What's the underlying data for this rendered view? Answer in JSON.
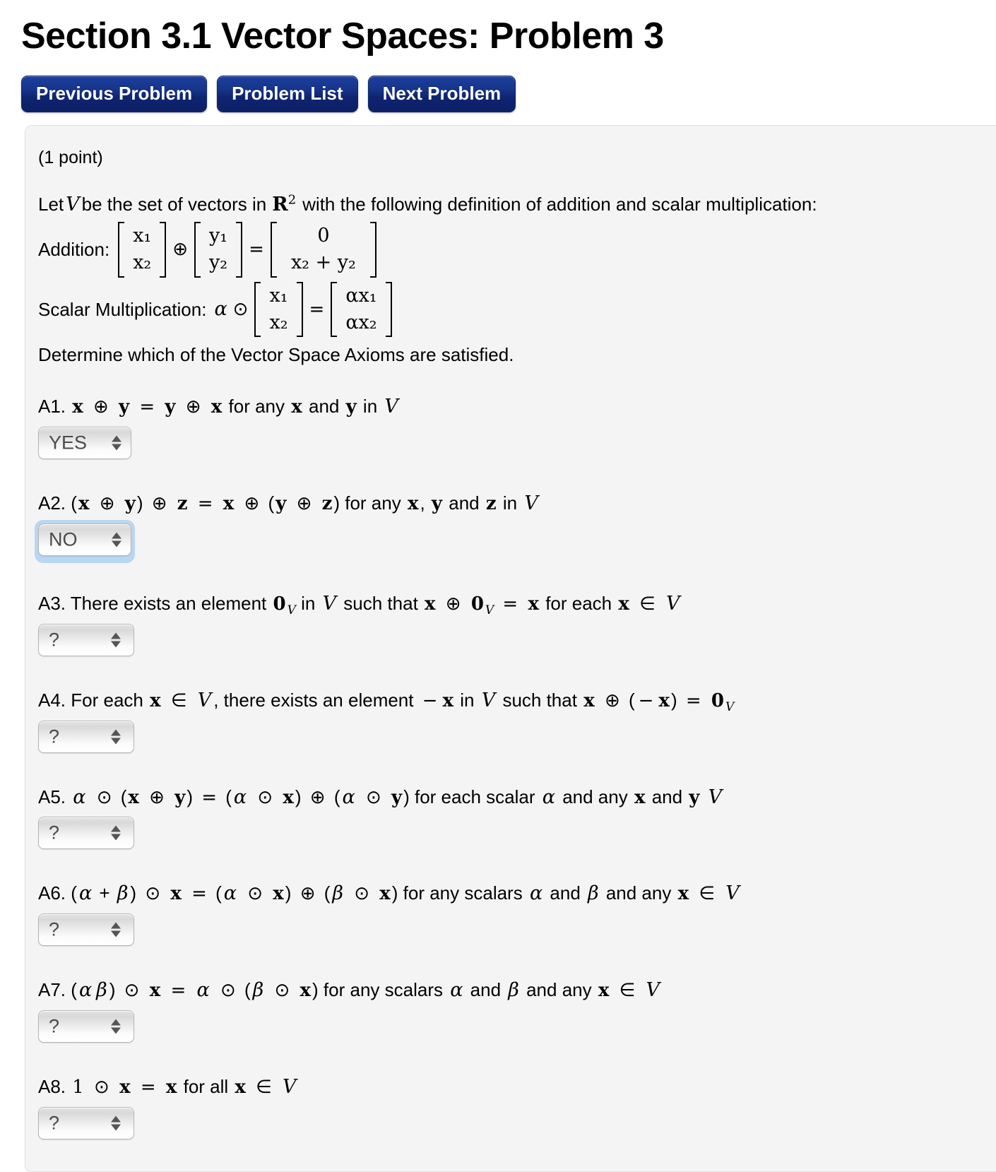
{
  "page_title": "Section 3.1 Vector Spaces: Problem 3",
  "nav": {
    "buttons": [
      {
        "label": "Previous Problem",
        "name": "previous-problem-button"
      },
      {
        "label": "Problem List",
        "name": "problem-list-button"
      },
      {
        "label": "Next Problem",
        "name": "next-problem-button"
      }
    ],
    "color": "#16348a"
  },
  "problem": {
    "points": "(1 point)",
    "intro": {
      "part1": "Let",
      "var_v": "V",
      "part2": "be the set of vectors in",
      "field": "R",
      "field_sup": "2",
      "part3": "with the following definition of addition and scalar multiplication:"
    },
    "addition": {
      "label": "Addition:",
      "left_top": "x₁",
      "left_bottom": "x₂",
      "op": "⊕",
      "mid_top": "y₁",
      "mid_bottom": "y₂",
      "equals": "=",
      "right_top": "0",
      "right_bottom": "x₂ + y₂"
    },
    "scalar": {
      "label": "Scalar Multiplication:",
      "alpha": "α",
      "op": "⊙",
      "left_top": "x₁",
      "left_bottom": "x₂",
      "equals": "=",
      "right_top": "αx₁",
      "right_bottom": "αx₂"
    },
    "determine": "Determine which of the Vector Space Axioms are satisfied."
  },
  "axioms": [
    {
      "id": "A1",
      "label": "A1.",
      "statement": "x ⊕ y = y ⊕ x for any x and y in V",
      "answer": "YES",
      "focused": false,
      "wide": false
    },
    {
      "id": "A2",
      "label": "A2.",
      "statement": "(x ⊕ y) ⊕ z = x ⊕ (y ⊕ z) for any x, y and z in V",
      "answer": "NO",
      "focused": true,
      "wide": false
    },
    {
      "id": "A3",
      "label": "A3.",
      "statement": "There exists an element 0V in V such that x ⊕ 0V = x for each x ∈ V",
      "answer": "?",
      "focused": false,
      "wide": true
    },
    {
      "id": "A4",
      "label": "A4.",
      "statement": "For each x ∈ V, there exists an element −x in V such that x ⊕ (−x) = 0V",
      "answer": "?",
      "focused": false,
      "wide": true
    },
    {
      "id": "A5",
      "label": "A5.",
      "statement": "α ⊙ (x ⊕ y) = (α ⊙ x) ⊕ (α ⊙ y) for each scalar α and any x and y V",
      "answer": "?",
      "focused": false,
      "wide": true
    },
    {
      "id": "A6",
      "label": "A6.",
      "statement": "(α + β) ⊙ x = (α ⊙ x) ⊕ (β ⊙ x) for any scalars α and β and any x ∈ V",
      "answer": "?",
      "focused": false,
      "wide": true
    },
    {
      "id": "A7",
      "label": "A7.",
      "statement": "(αβ) ⊙ x = α ⊙ (β ⊙ x) for any scalars α and β and any x ∈ V",
      "answer": "?",
      "focused": false,
      "wide": true
    },
    {
      "id": "A8",
      "label": "A8.",
      "statement": "1 ⊙ x = x for all x ∈ V",
      "answer": "?",
      "focused": false,
      "wide": true
    }
  ],
  "select_options": [
    "?",
    "YES",
    "NO"
  ],
  "icons": {
    "arrow_up": "triangle-up-icon",
    "arrow_down": "triangle-down-icon"
  }
}
